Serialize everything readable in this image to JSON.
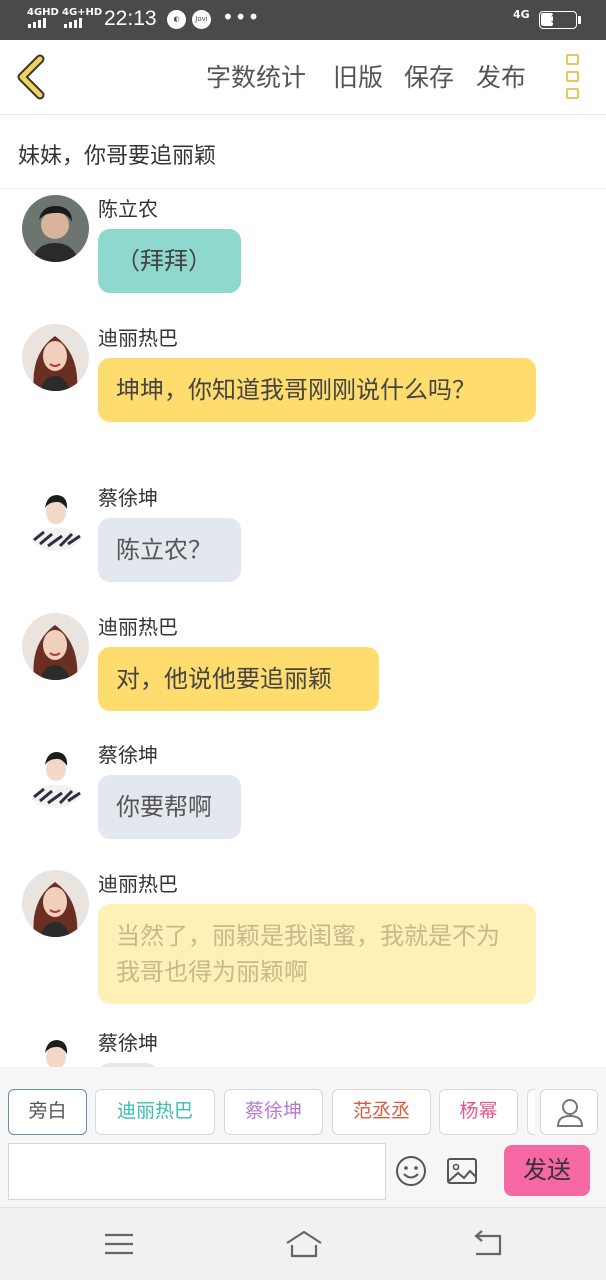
{
  "status_bar": {
    "network1": "4GHD",
    "network2": "4G+HD",
    "time": "22:13",
    "app_icon_label": "Jovi",
    "more": "•••",
    "network_right": "4G",
    "battery_percent": 35
  },
  "header": {
    "back_icon": "chevron-left-icon",
    "actions": [
      "字数统计",
      "旧版",
      "保存",
      "发布"
    ],
    "more_icon": "more-vertical-icon"
  },
  "story_title": "妹妹，你哥要追丽颖",
  "messages": [
    {
      "sender": "陈立农",
      "text": "（拜拜）",
      "style": "teal",
      "avatar": "male-avatar-dark"
    },
    {
      "sender": "迪丽热巴",
      "text": "坤坤，你知道我哥刚刚说什么吗？",
      "style": "yellow",
      "avatar": "female-avatar"
    },
    {
      "sender": "蔡徐坤",
      "text": "陈立农？",
      "style": "grey",
      "avatar": "male-avatar-light"
    },
    {
      "sender": "迪丽热巴",
      "text": "对，他说他要追丽颖",
      "style": "yellow",
      "avatar": "female-avatar"
    },
    {
      "sender": "蔡徐坤",
      "text": "你要帮啊",
      "style": "grey",
      "avatar": "male-avatar-light"
    },
    {
      "sender": "迪丽热巴",
      "text": "当然了，丽颖是我闺蜜，我就是不为我哥也得为丽颖啊",
      "style": "faded",
      "avatar": "female-avatar"
    },
    {
      "sender": "蔡徐坤",
      "text": "",
      "style": "grey",
      "avatar": "male-avatar-light"
    }
  ],
  "characters": [
    {
      "name": "旁白",
      "color": "#555555",
      "active": true
    },
    {
      "name": "迪丽热巴",
      "color": "#3bbdb0",
      "active": false
    },
    {
      "name": "蔡徐坤",
      "color": "#b57ad6",
      "active": false
    },
    {
      "name": "范丞丞",
      "color": "#e0573e",
      "active": false
    },
    {
      "name": "杨幂",
      "color": "#e0578f",
      "active": false
    }
  ],
  "input": {
    "placeholder": "",
    "value": "",
    "send_label": "发送"
  },
  "colors": {
    "accent_yellow": "#e8c65a",
    "bubble_teal": "#8fd8cd",
    "bubble_yellow": "#fedd6e",
    "bubble_grey": "#e3e8ee",
    "send_pink": "#f668a4"
  },
  "nav": {
    "menu_icon": "menu-icon",
    "home_icon": "home-icon",
    "back_icon": "back-arrow-icon"
  }
}
